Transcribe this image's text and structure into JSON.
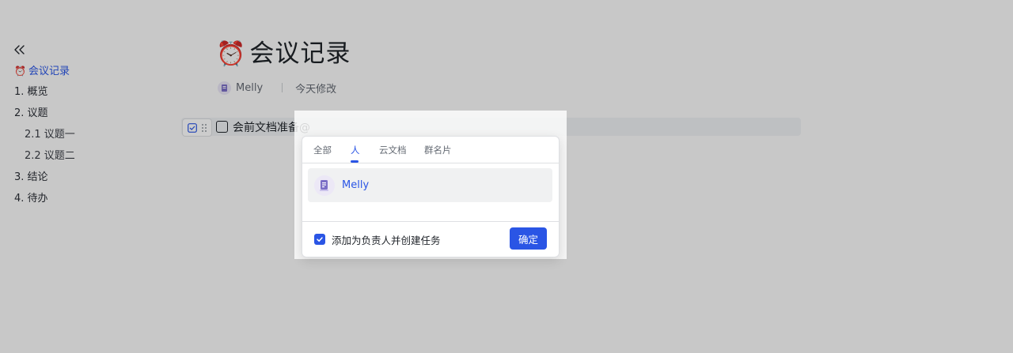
{
  "sidebar": {
    "toc": [
      {
        "label": "会议记录",
        "emoji": "⏰",
        "active": true
      },
      {
        "label": "1. 概览"
      },
      {
        "label": "2. 议题"
      },
      {
        "label": "2.1 议题一",
        "sub": true
      },
      {
        "label": "2.2 议题二",
        "sub": true
      },
      {
        "label": "3. 结论"
      },
      {
        "label": "4. 待办"
      }
    ]
  },
  "doc": {
    "title_emoji": "⏰",
    "title": "会议记录",
    "author": "Melly",
    "modified": "今天修改",
    "task_text": "会前文档准备@"
  },
  "mention_popup": {
    "tabs": [
      "全部",
      "人",
      "云文档",
      "群名片"
    ],
    "active_tab": "人",
    "result_name": "Melly",
    "assign_label": "添加为负责人并创建任务",
    "assign_checked": true,
    "confirm_label": "确定"
  },
  "colors": {
    "accent": "#2a55e5"
  }
}
